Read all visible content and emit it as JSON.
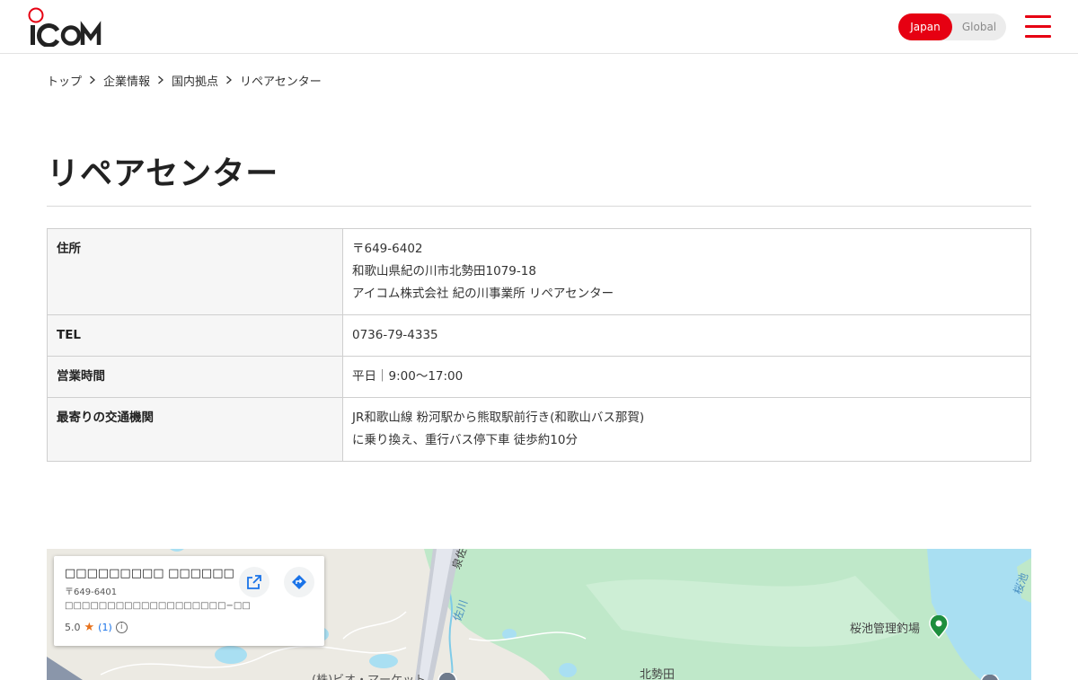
{
  "header": {
    "logo_text": "ICOM",
    "lang": {
      "japan": "Japan",
      "global": "Global"
    },
    "accent": "#e60012"
  },
  "breadcrumb": [
    "トップ",
    "企業情報",
    "国内拠点",
    "リペアセンター"
  ],
  "page": {
    "title": "リペアセンター"
  },
  "table": {
    "rows": [
      {
        "label": "住所",
        "lines": [
          "〒649-6402",
          "和歌山県紀の川市北勢田1079-18",
          "アイコム株式会社 紀の川事業所 リペアセンター"
        ]
      },
      {
        "label": "TEL",
        "lines": [
          "0736-79-4335"
        ]
      },
      {
        "label": "営業時間",
        "lines": [
          "平日｜9:00〜17:00"
        ]
      },
      {
        "label": "最寄りの交通機関",
        "lines": [
          "JR和歌山線 粉河駅から熊取駅前行き(和歌山バス那賀)",
          "に乗り換え、重行バス停下車 徒歩約10分"
        ]
      }
    ]
  },
  "map": {
    "card": {
      "name": "□□□□□□□□□ □□□□□□",
      "address": "〒649-6401 □□□□□□□□□□□□□□□□□□□−□□",
      "rating": "5.0",
      "reviews": "(1)"
    },
    "labels": {
      "pond_mgmt": "桜池管理釣場",
      "kita_seda": "北勢田",
      "market": "(株)ビオ・マーケット",
      "river_izumi": "泉佐",
      "river_sa": "佐川",
      "sakura": "桜池"
    },
    "icons": [
      "open-in-new-icon",
      "directions-icon",
      "star-icon",
      "info-icon",
      "map-pin-icon"
    ]
  }
}
